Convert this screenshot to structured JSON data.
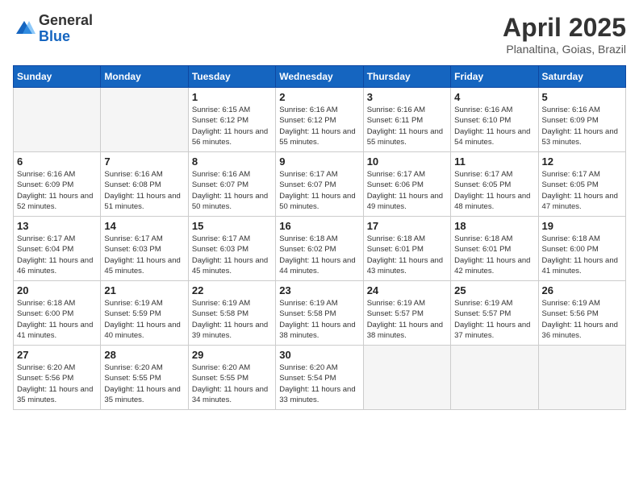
{
  "logo": {
    "general": "General",
    "blue": "Blue"
  },
  "title": "April 2025",
  "location": "Planaltina, Goias, Brazil",
  "headers": [
    "Sunday",
    "Monday",
    "Tuesday",
    "Wednesday",
    "Thursday",
    "Friday",
    "Saturday"
  ],
  "weeks": [
    [
      {
        "day": "",
        "info": ""
      },
      {
        "day": "",
        "info": ""
      },
      {
        "day": "1",
        "info": "Sunrise: 6:15 AM\nSunset: 6:12 PM\nDaylight: 11 hours and 56 minutes."
      },
      {
        "day": "2",
        "info": "Sunrise: 6:16 AM\nSunset: 6:12 PM\nDaylight: 11 hours and 55 minutes."
      },
      {
        "day": "3",
        "info": "Sunrise: 6:16 AM\nSunset: 6:11 PM\nDaylight: 11 hours and 55 minutes."
      },
      {
        "day": "4",
        "info": "Sunrise: 6:16 AM\nSunset: 6:10 PM\nDaylight: 11 hours and 54 minutes."
      },
      {
        "day": "5",
        "info": "Sunrise: 6:16 AM\nSunset: 6:09 PM\nDaylight: 11 hours and 53 minutes."
      }
    ],
    [
      {
        "day": "6",
        "info": "Sunrise: 6:16 AM\nSunset: 6:09 PM\nDaylight: 11 hours and 52 minutes."
      },
      {
        "day": "7",
        "info": "Sunrise: 6:16 AM\nSunset: 6:08 PM\nDaylight: 11 hours and 51 minutes."
      },
      {
        "day": "8",
        "info": "Sunrise: 6:16 AM\nSunset: 6:07 PM\nDaylight: 11 hours and 50 minutes."
      },
      {
        "day": "9",
        "info": "Sunrise: 6:17 AM\nSunset: 6:07 PM\nDaylight: 11 hours and 50 minutes."
      },
      {
        "day": "10",
        "info": "Sunrise: 6:17 AM\nSunset: 6:06 PM\nDaylight: 11 hours and 49 minutes."
      },
      {
        "day": "11",
        "info": "Sunrise: 6:17 AM\nSunset: 6:05 PM\nDaylight: 11 hours and 48 minutes."
      },
      {
        "day": "12",
        "info": "Sunrise: 6:17 AM\nSunset: 6:05 PM\nDaylight: 11 hours and 47 minutes."
      }
    ],
    [
      {
        "day": "13",
        "info": "Sunrise: 6:17 AM\nSunset: 6:04 PM\nDaylight: 11 hours and 46 minutes."
      },
      {
        "day": "14",
        "info": "Sunrise: 6:17 AM\nSunset: 6:03 PM\nDaylight: 11 hours and 45 minutes."
      },
      {
        "day": "15",
        "info": "Sunrise: 6:17 AM\nSunset: 6:03 PM\nDaylight: 11 hours and 45 minutes."
      },
      {
        "day": "16",
        "info": "Sunrise: 6:18 AM\nSunset: 6:02 PM\nDaylight: 11 hours and 44 minutes."
      },
      {
        "day": "17",
        "info": "Sunrise: 6:18 AM\nSunset: 6:01 PM\nDaylight: 11 hours and 43 minutes."
      },
      {
        "day": "18",
        "info": "Sunrise: 6:18 AM\nSunset: 6:01 PM\nDaylight: 11 hours and 42 minutes."
      },
      {
        "day": "19",
        "info": "Sunrise: 6:18 AM\nSunset: 6:00 PM\nDaylight: 11 hours and 41 minutes."
      }
    ],
    [
      {
        "day": "20",
        "info": "Sunrise: 6:18 AM\nSunset: 6:00 PM\nDaylight: 11 hours and 41 minutes."
      },
      {
        "day": "21",
        "info": "Sunrise: 6:19 AM\nSunset: 5:59 PM\nDaylight: 11 hours and 40 minutes."
      },
      {
        "day": "22",
        "info": "Sunrise: 6:19 AM\nSunset: 5:58 PM\nDaylight: 11 hours and 39 minutes."
      },
      {
        "day": "23",
        "info": "Sunrise: 6:19 AM\nSunset: 5:58 PM\nDaylight: 11 hours and 38 minutes."
      },
      {
        "day": "24",
        "info": "Sunrise: 6:19 AM\nSunset: 5:57 PM\nDaylight: 11 hours and 38 minutes."
      },
      {
        "day": "25",
        "info": "Sunrise: 6:19 AM\nSunset: 5:57 PM\nDaylight: 11 hours and 37 minutes."
      },
      {
        "day": "26",
        "info": "Sunrise: 6:19 AM\nSunset: 5:56 PM\nDaylight: 11 hours and 36 minutes."
      }
    ],
    [
      {
        "day": "27",
        "info": "Sunrise: 6:20 AM\nSunset: 5:56 PM\nDaylight: 11 hours and 35 minutes."
      },
      {
        "day": "28",
        "info": "Sunrise: 6:20 AM\nSunset: 5:55 PM\nDaylight: 11 hours and 35 minutes."
      },
      {
        "day": "29",
        "info": "Sunrise: 6:20 AM\nSunset: 5:55 PM\nDaylight: 11 hours and 34 minutes."
      },
      {
        "day": "30",
        "info": "Sunrise: 6:20 AM\nSunset: 5:54 PM\nDaylight: 11 hours and 33 minutes."
      },
      {
        "day": "",
        "info": ""
      },
      {
        "day": "",
        "info": ""
      },
      {
        "day": "",
        "info": ""
      }
    ]
  ]
}
